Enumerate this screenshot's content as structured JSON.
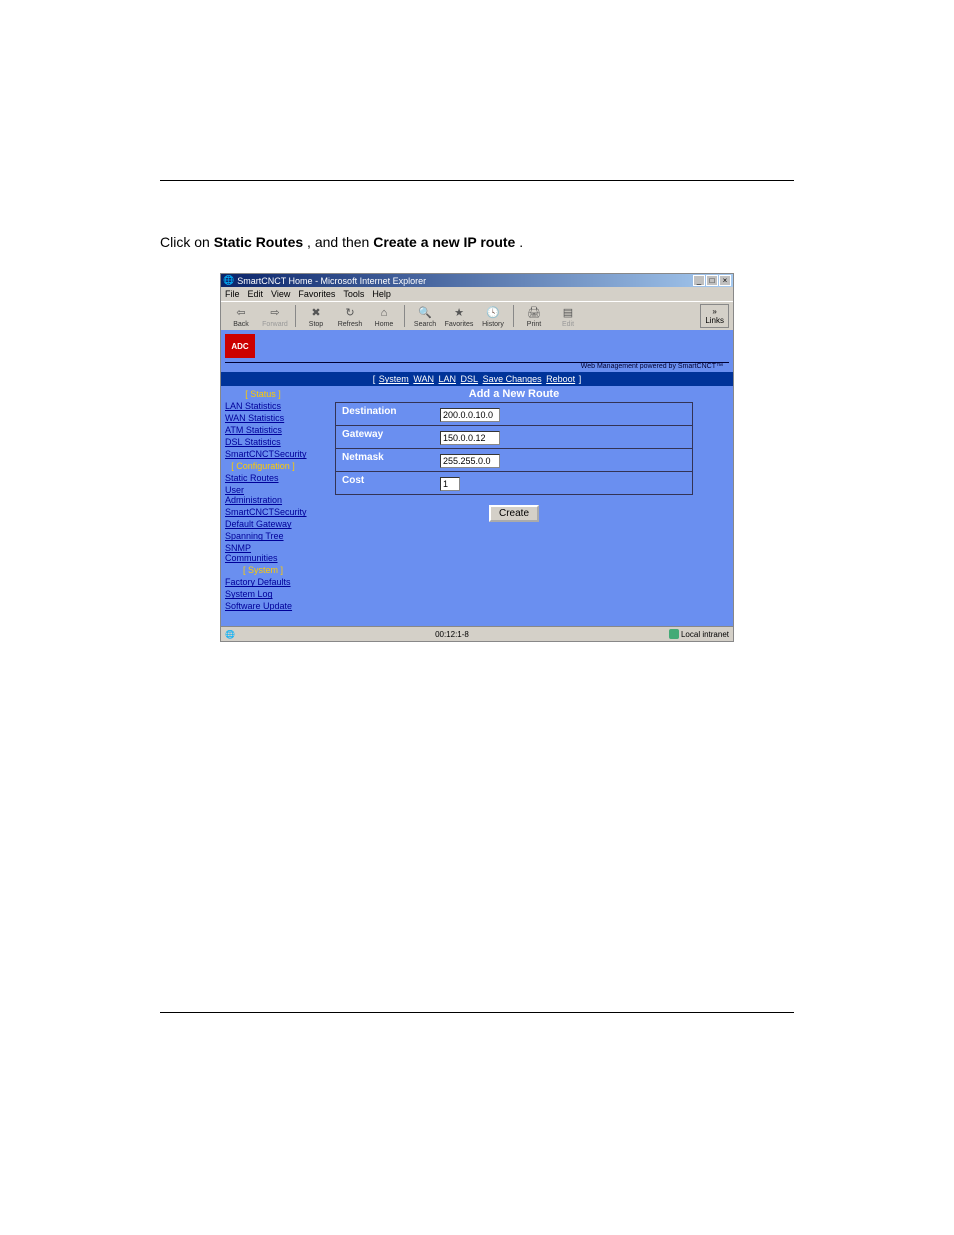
{
  "instruction": {
    "prefix": "Click on ",
    "link1": "Static Routes",
    "middle": ", and then ",
    "link2": "Create a new IP route",
    "suffix": "."
  },
  "window": {
    "title": "SmartCNCT Home - Microsoft Internet Explorer",
    "min": "_",
    "max": "□",
    "close": "×"
  },
  "menubar": {
    "file": "File",
    "edit": "Edit",
    "view": "View",
    "favorites": "Favorites",
    "tools": "Tools",
    "help": "Help"
  },
  "toolbar": {
    "back": "Back",
    "forward": "Forward",
    "stop": "Stop",
    "refresh": "Refresh",
    "home": "Home",
    "search": "Search",
    "fav": "Favorites",
    "history": "History",
    "print": "Print",
    "edit": "Edit",
    "links": "Links"
  },
  "brand": {
    "logo": "ADC",
    "tagline": "Web Management powered by SmartCNCT™"
  },
  "topnav": {
    "system": "System",
    "wan": "WAN",
    "lan": "LAN",
    "dsl": "DSL",
    "save": "Save Changes",
    "reboot": "Reboot"
  },
  "sidebar": {
    "cat_status": "[ Status ]",
    "lan_stats": "LAN Statistics",
    "wan_stats": "WAN Statistics",
    "atm_stats": "ATM Statistics",
    "dsl_stats": "DSL Statistics",
    "smt_sec": "SmartCNCTSecurity",
    "cat_config": "[ Configuration ]",
    "static_routes": "Static Routes",
    "user_admin": "User Administration",
    "smt_sec2": "SmartCNCTSecurity",
    "def_gw": "Default Gateway",
    "spanning": "Spanning Tree",
    "snmp": "SNMP Communities",
    "cat_system": "[ System ]",
    "factory": "Factory Defaults",
    "syslog": "System Log",
    "swupdate": "Software Update"
  },
  "form": {
    "title": "Add a New Route",
    "dest_label": "Destination",
    "gw_label": "Gateway",
    "mask_label": "Netmask",
    "cost_label": "Cost",
    "dest_val": "200.0.0.10.0",
    "gw_val": "150.0.0.12",
    "mask_val": "255.255.0.0",
    "cost_val": "1",
    "create_btn": "Create"
  },
  "statusbar": {
    "center": "00:12:1-8",
    "zone": "Local intranet"
  }
}
